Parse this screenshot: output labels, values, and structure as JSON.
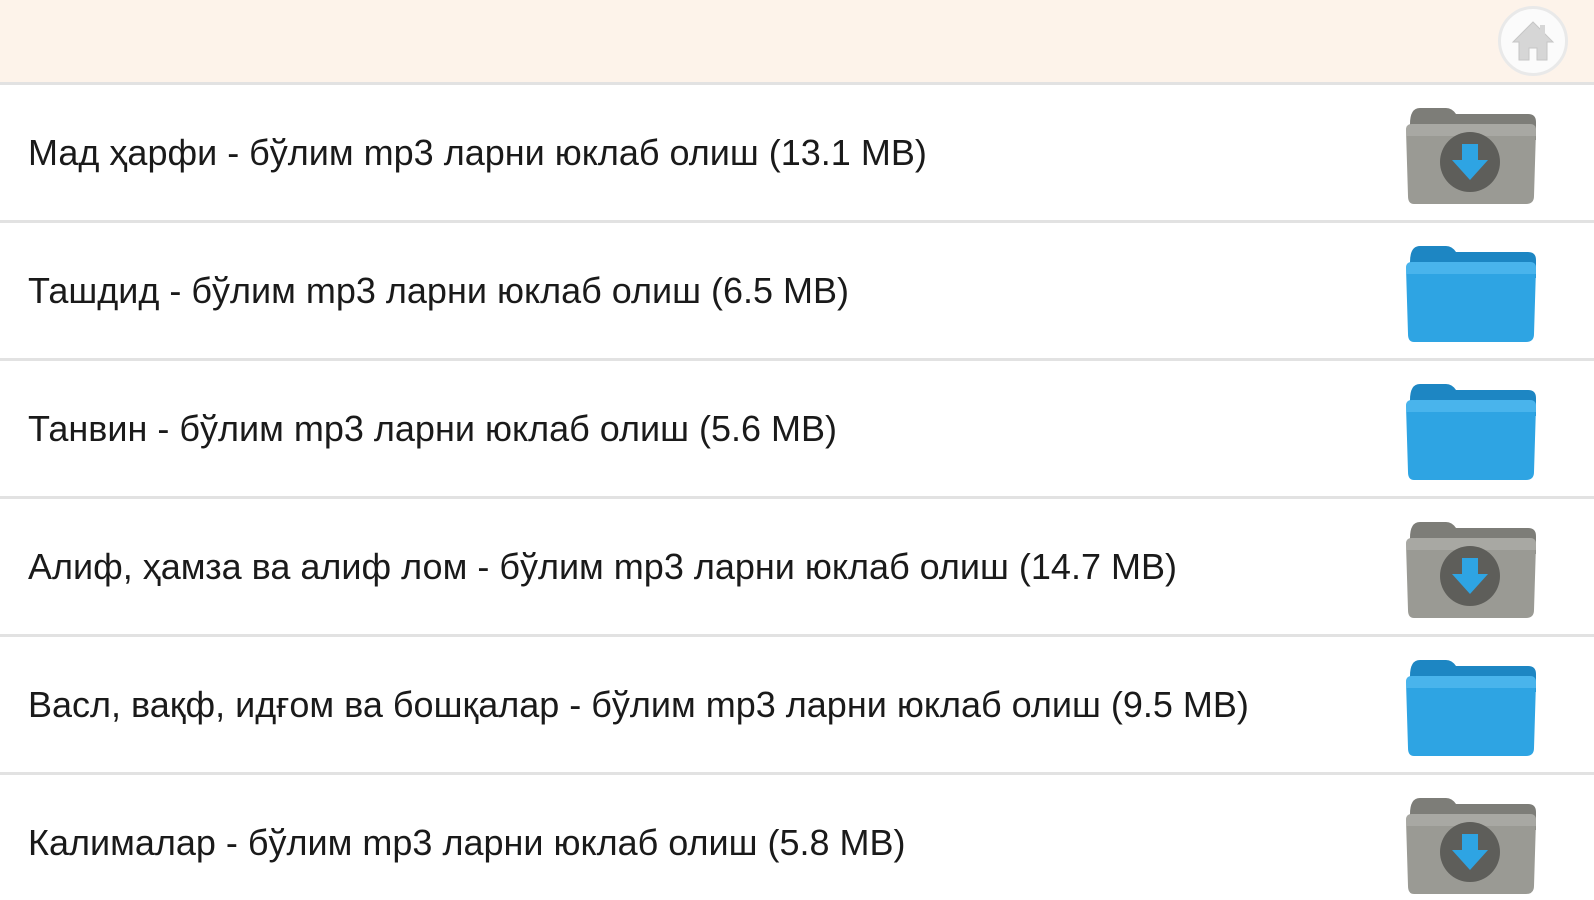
{
  "header": {
    "home_icon": "home-icon",
    "colors": {
      "background": "#fdf3ea",
      "home": "#d4d4d4"
    }
  },
  "items": [
    {
      "label": "Мад ҳарфи - бўлим mp3 ларни юклаб олиш (13.1 MB)",
      "status": "download",
      "icon": "folder-download-icon"
    },
    {
      "label": "Ташдид - бўлим mp3 ларни юклаб олиш (6.5 MB)",
      "status": "downloaded",
      "icon": "folder-icon"
    },
    {
      "label": "Танвин - бўлим mp3 ларни юклаб олиш (5.6 MB)",
      "status": "downloaded",
      "icon": "folder-icon"
    },
    {
      "label": "Алиф, ҳамза ва алиф лом - бўлим mp3 ларни юклаб олиш (14.7 MB)",
      "status": "download",
      "icon": "folder-download-icon"
    },
    {
      "label": "Васл, вақф, идғом ва бошқалар - бўлим mp3 ларни юклаб олиш (9.5 MB)",
      "status": "downloaded",
      "icon": "folder-icon"
    },
    {
      "label": "Калималар - бўлим mp3 ларни юклаб олиш (5.8 MB)",
      "status": "download",
      "icon": "folder-download-icon"
    }
  ],
  "colors": {
    "folder_blue": "#2ea4e3",
    "folder_gray": "#9a9a94",
    "divider": "#e2e2e2",
    "text": "#1a1a1a"
  }
}
